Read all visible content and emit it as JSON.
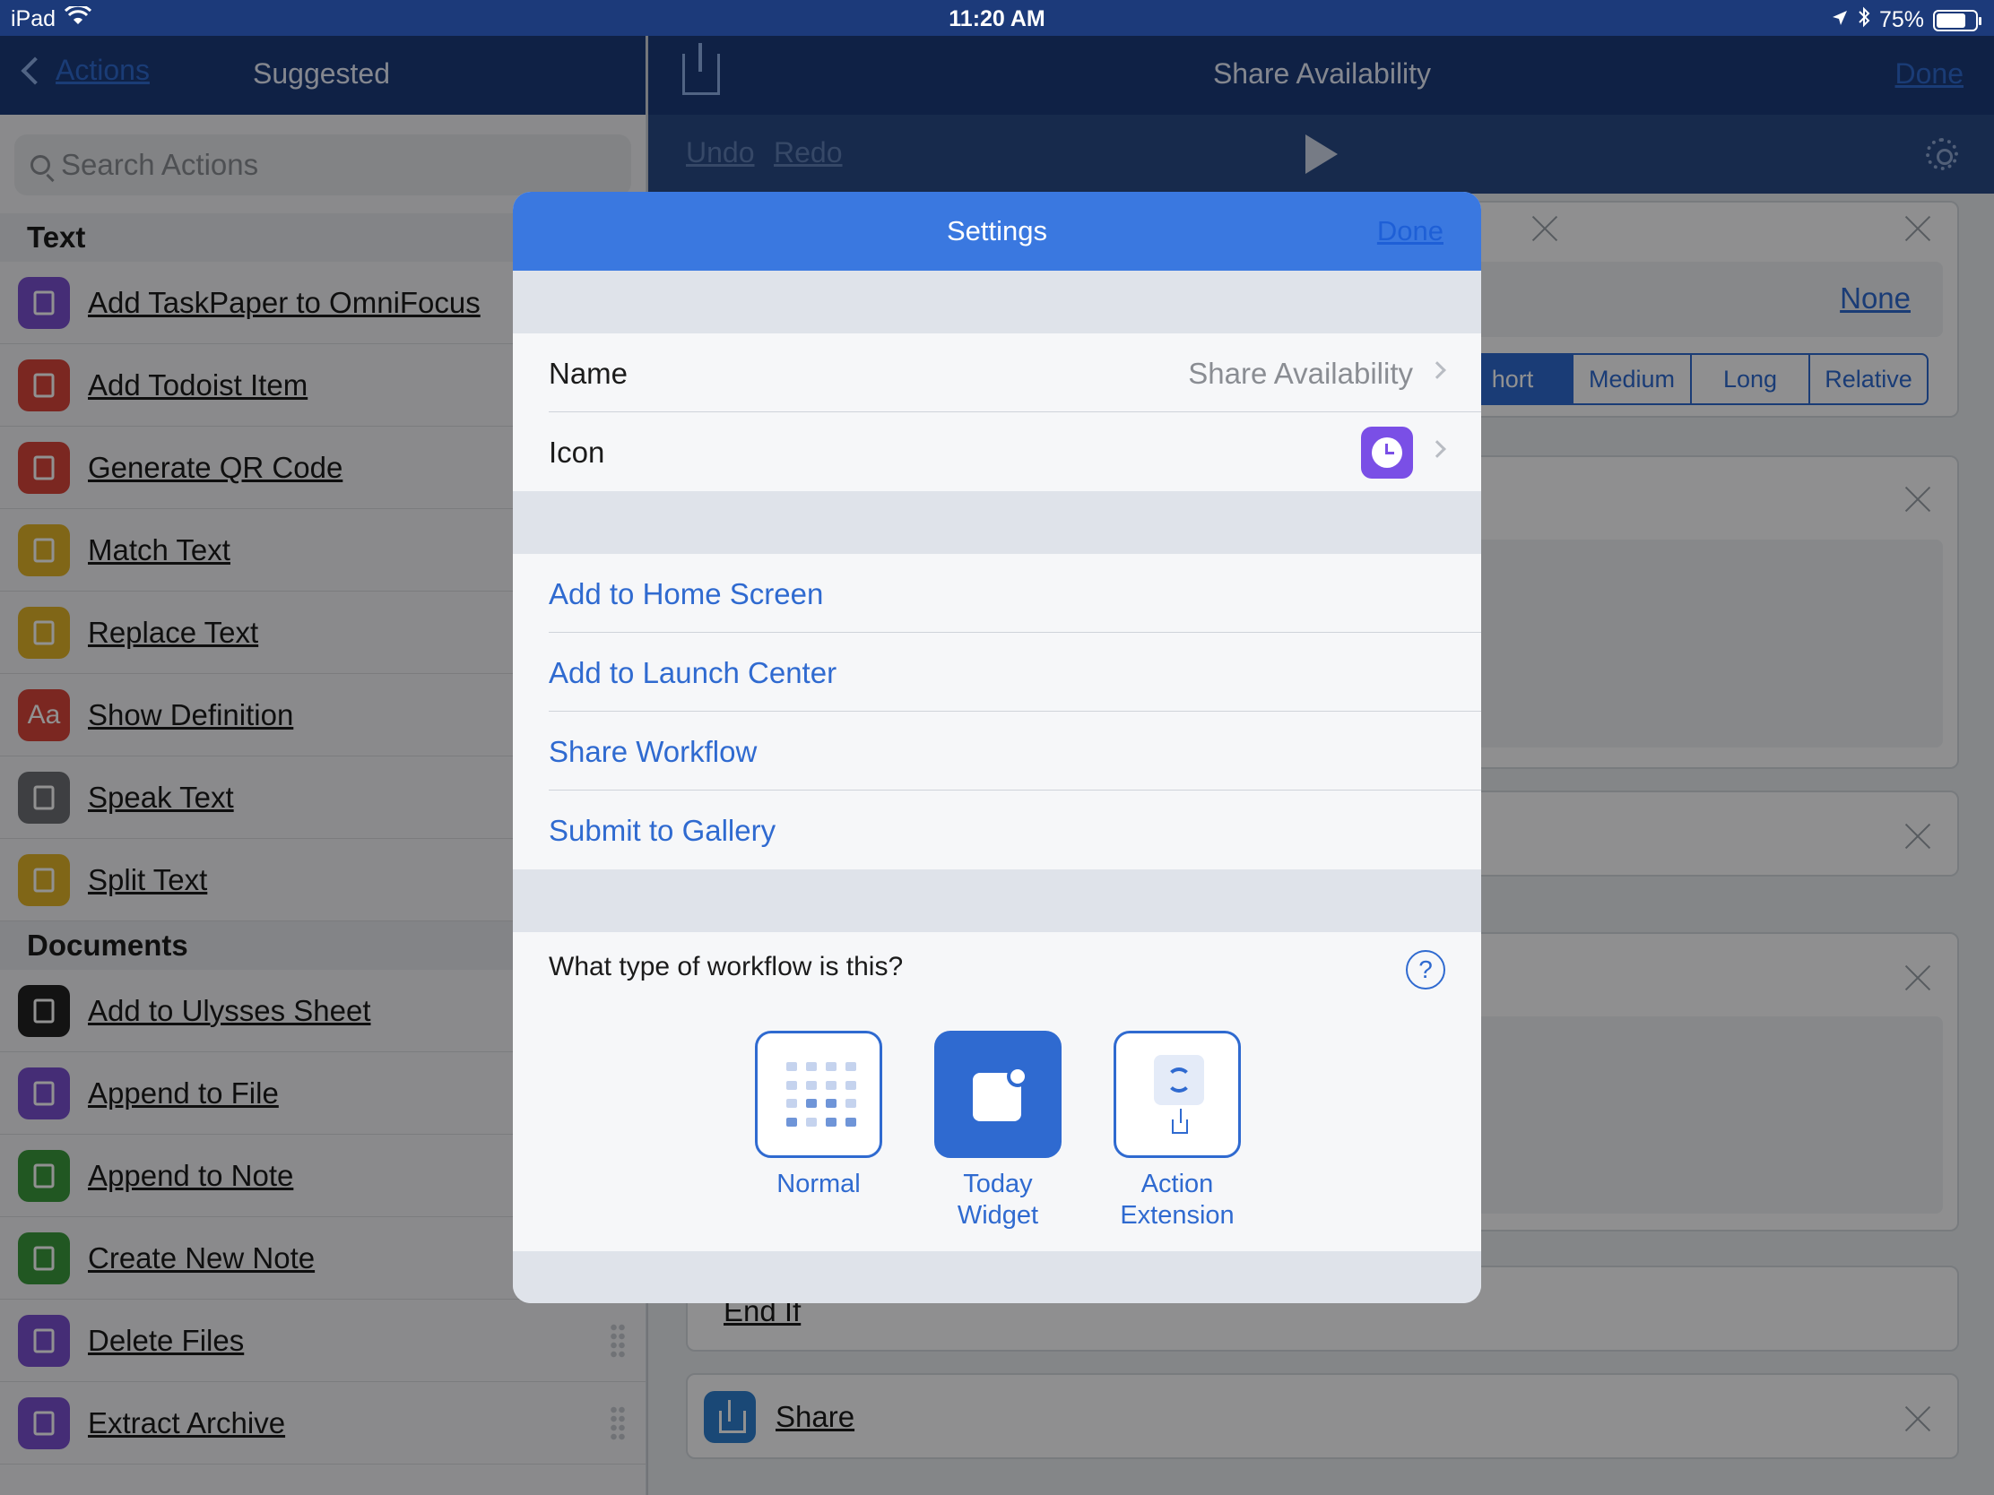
{
  "status_bar": {
    "device": "iPad",
    "time": "11:20 AM",
    "battery": "75%",
    "battery_level": 0.75
  },
  "left_nav": {
    "back_label": "Actions",
    "title": "Suggested"
  },
  "search": {
    "placeholder": "Search Actions"
  },
  "sections": [
    {
      "header": "Text",
      "items": [
        {
          "label": "Add TaskPaper to OmniFocus",
          "icon": "checkmark-icon",
          "color": "#7a4fd0"
        },
        {
          "label": "Add Todoist Item",
          "icon": "todoist-icon",
          "color": "#d9453b"
        },
        {
          "label": "Generate QR Code",
          "icon": "qr-code-icon",
          "color": "#d9453b"
        },
        {
          "label": "Match Text",
          "icon": "text-doc-icon",
          "color": "#e2b32a"
        },
        {
          "label": "Replace Text",
          "icon": "text-doc-icon",
          "color": "#e2b32a"
        },
        {
          "label": "Show Definition",
          "icon": "dictionary-icon",
          "color": "#d9453b",
          "glyph": "Aa"
        },
        {
          "label": "Speak Text",
          "icon": "gear-icon",
          "color": "#6d6f75"
        },
        {
          "label": "Split Text",
          "icon": "text-doc-icon",
          "color": "#e2b32a"
        }
      ]
    },
    {
      "header": "Documents",
      "items": [
        {
          "label": "Add to Ulysses Sheet",
          "icon": "butterfly-icon",
          "color": "#222222"
        },
        {
          "label": "Append to File",
          "icon": "file-icon",
          "color": "#7a4fd0"
        },
        {
          "label": "Append to Note",
          "icon": "evernote-icon",
          "color": "#3a9a3c"
        },
        {
          "label": "Create New Note",
          "icon": "evernote-icon",
          "color": "#3a9a3c"
        },
        {
          "label": "Delete Files",
          "icon": "file-icon",
          "color": "#7a4fd0"
        },
        {
          "label": "Extract Archive",
          "icon": "file-icon",
          "color": "#7a4fd0"
        }
      ]
    }
  ],
  "right_nav": {
    "title": "Share Availability",
    "done_label": "Done"
  },
  "toolbar": {
    "undo_label": "Undo",
    "redo_label": "Redo"
  },
  "workflow_cards": {
    "none_label": "None",
    "format_segments": [
      "hort",
      "Medium",
      "Long",
      "Relative"
    ],
    "end_if_label": "End If",
    "share_label": "Share"
  },
  "settings_modal": {
    "title": "Settings",
    "done_label": "Done",
    "name_label": "Name",
    "name_value": "Share Availability",
    "icon_label": "Icon",
    "links": [
      "Add to Home Screen",
      "Add to Launch Center",
      "Share Workflow",
      "Submit to Gallery"
    ],
    "type_question": "What type of workflow is this?",
    "help_glyph": "?",
    "types": [
      {
        "label": "Normal",
        "selected": false
      },
      {
        "label": "Today Widget",
        "selected": true
      },
      {
        "label": "Action Extension",
        "selected": false
      }
    ]
  }
}
